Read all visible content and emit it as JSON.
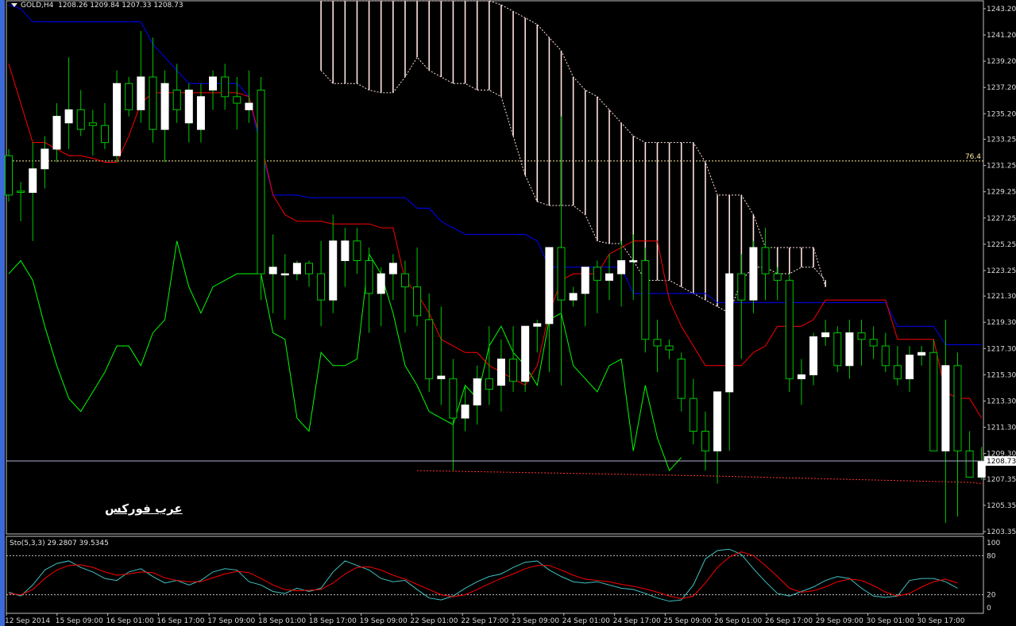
{
  "header": {
    "symbol": "GOLD,H4",
    "open": "1208.26",
    "high": "1209.84",
    "low": "1207.33",
    "close": "1208.73"
  },
  "indicator": {
    "name": "Sto(5,3,3)",
    "main": "29.2807",
    "signal": "39.5345"
  },
  "watermark": "عرب فوركس",
  "colors": {
    "background": "#000000",
    "grid_border": "#c0c0c0",
    "bull_candle": "#ffffff",
    "bear_candle": "#000000",
    "wick": "#00c800",
    "kijun": "#0000ff",
    "tenkan": "#ff0000",
    "chikou": "#00ff00",
    "cloud": "#ffe4e1",
    "stoch_main": "#40c0c0",
    "stoch_signal": "#ff0000",
    "level_line": "#ffeba0"
  },
  "chart_data": [
    {
      "type": "candlestick",
      "title": "",
      "ylim": [
        1202.5,
        1244.0
      ],
      "y_ticks": [
        "1243.20",
        "1241.20",
        "1239.20",
        "1237.20",
        "1235.20",
        "1233.25",
        "1231.25",
        "1229.25",
        "1227.25",
        "1225.25",
        "1223.25",
        "1221.30",
        "1219.30",
        "1217.30",
        "1215.30",
        "1213.30",
        "1211.30",
        "1209.30",
        "1207.35",
        "1205.35",
        "1203.35"
      ],
      "x_ticks": [
        "12 Sep 2014",
        "15 Sep 09:00",
        "16 Sep 01:00",
        "16 Sep 17:00",
        "17 Sep 09:00",
        "18 Sep 01:00",
        "18 Sep 17:00",
        "19 Sep 09:00",
        "22 Sep 01:00",
        "22 Sep 17:00",
        "23 Sep 09:00",
        "24 Sep 01:00",
        "24 Sep 17:00",
        "25 Sep 09:00",
        "26 Sep 01:00",
        "26 Sep 17:00",
        "29 Sep 09:00",
        "30 Sep 01:00",
        "30 Sep 17:00"
      ],
      "current_price": "1208.73",
      "current_price_value": 1208.73,
      "level": {
        "label": "76.4",
        "value": 1231.6
      },
      "ohlc": [
        [
          1232.0,
          1232.5,
          1228.5,
          1229.0
        ],
        [
          1229.3,
          1230.0,
          1227.0,
          1229.2
        ],
        [
          1229.2,
          1233.0,
          1225.5,
          1231.0
        ],
        [
          1231.0,
          1233.5,
          1229.5,
          1232.5
        ],
        [
          1232.5,
          1236.0,
          1231.5,
          1235.0
        ],
        [
          1234.5,
          1239.5,
          1232.5,
          1235.5
        ],
        [
          1235.5,
          1237.0,
          1233.5,
          1234.0
        ],
        [
          1234.5,
          1235.5,
          1232.0,
          1234.3
        ],
        [
          1234.3,
          1236.0,
          1232.5,
          1233.0
        ],
        [
          1232.0,
          1238.5,
          1231.5,
          1237.5
        ],
        [
          1237.5,
          1238.0,
          1235.0,
          1235.5
        ],
        [
          1235.5,
          1241.5,
          1234.5,
          1238.0
        ],
        [
          1238.0,
          1241.0,
          1233.0,
          1234.0
        ],
        [
          1234.0,
          1238.5,
          1231.5,
          1237.5
        ],
        [
          1237.0,
          1239.0,
          1234.5,
          1235.5
        ],
        [
          1234.5,
          1237.5,
          1233.0,
          1237.0
        ],
        [
          1234.0,
          1237.5,
          1233.0,
          1236.5
        ],
        [
          1237.0,
          1238.5,
          1235.5,
          1238.0
        ],
        [
          1238.0,
          1239.0,
          1235.5,
          1236.5
        ],
        [
          1236.5,
          1238.0,
          1234.0,
          1236.0
        ],
        [
          1235.5,
          1238.5,
          1234.5,
          1236.0
        ],
        [
          1237.0,
          1238.0,
          1221.0,
          1223.0
        ],
        [
          1223.0,
          1226.0,
          1220.0,
          1223.5
        ],
        [
          1223.0,
          1224.5,
          1219.5,
          1223.0
        ],
        [
          1223.0,
          1224.0,
          1222.5,
          1223.8
        ],
        [
          1223.8,
          1224.0,
          1222.0,
          1223.0
        ],
        [
          1223.0,
          1225.5,
          1219.0,
          1221.0
        ],
        [
          1221.0,
          1227.5,
          1220.0,
          1225.5
        ],
        [
          1224.0,
          1226.5,
          1222.0,
          1225.5
        ],
        [
          1225.5,
          1226.5,
          1223.0,
          1224.0
        ],
        [
          1224.0,
          1225.0,
          1218.5,
          1221.5
        ],
        [
          1221.5,
          1223.5,
          1219.0,
          1223.0
        ],
        [
          1223.0,
          1224.5,
          1221.0,
          1223.8
        ],
        [
          1223.0,
          1224.0,
          1218.5,
          1222.0
        ],
        [
          1222.0,
          1225.0,
          1219.0,
          1219.8
        ],
        [
          1219.5,
          1221.5,
          1214.0,
          1215.0
        ],
        [
          1215.0,
          1220.5,
          1213.0,
          1215.2
        ],
        [
          1215.0,
          1216.5,
          1208.0,
          1212.0
        ],
        [
          1212.0,
          1214.5,
          1211.0,
          1213.0
        ],
        [
          1213.0,
          1216.0,
          1211.5,
          1215.0
        ],
        [
          1215.0,
          1219.0,
          1213.0,
          1214.2
        ],
        [
          1214.5,
          1218.0,
          1212.5,
          1216.5
        ],
        [
          1216.5,
          1219.0,
          1214.0,
          1214.8
        ],
        [
          1214.8,
          1219.0,
          1214.0,
          1219.0
        ],
        [
          1219.0,
          1219.5,
          1217.0,
          1219.2
        ],
        [
          1219.2,
          1225.0,
          1215.5,
          1225.0
        ],
        [
          1225.0,
          1235.0,
          1214.5,
          1221.0
        ],
        [
          1221.0,
          1222.0,
          1220.5,
          1221.5
        ],
        [
          1221.5,
          1223.5,
          1219.0,
          1223.5
        ],
        [
          1223.5,
          1224.0,
          1220.0,
          1222.5
        ],
        [
          1222.5,
          1224.5,
          1221.0,
          1223.0
        ],
        [
          1223.0,
          1225.5,
          1220.5,
          1224.0
        ],
        [
          1224.0,
          1226.0,
          1221.0,
          1224.0
        ],
        [
          1224.0,
          1225.0,
          1217.0,
          1218.0
        ],
        [
          1218.0,
          1219.5,
          1215.5,
          1217.5
        ],
        [
          1217.5,
          1218.0,
          1216.5,
          1217.2
        ],
        [
          1216.5,
          1217.0,
          1212.5,
          1213.5
        ],
        [
          1213.5,
          1215.0,
          1210.0,
          1211.0
        ],
        [
          1211.0,
          1212.5,
          1208.0,
          1209.5
        ],
        [
          1209.5,
          1211.0,
          1207.0,
          1214.0
        ],
        [
          1214.0,
          1218.5,
          1209.5,
          1223.0
        ],
        [
          1223.0,
          1224.5,
          1216.5,
          1221.0
        ],
        [
          1221.0,
          1225.5,
          1220.0,
          1225.0
        ],
        [
          1225.0,
          1226.5,
          1221.0,
          1223.0
        ],
        [
          1223.0,
          1223.5,
          1221.0,
          1222.5
        ],
        [
          1222.5,
          1223.0,
          1214.0,
          1215.0
        ],
        [
          1215.0,
          1216.5,
          1213.0,
          1215.3
        ],
        [
          1215.3,
          1218.5,
          1214.5,
          1218.2
        ],
        [
          1218.2,
          1219.5,
          1217.5,
          1218.5
        ],
        [
          1218.5,
          1219.0,
          1215.5,
          1216.0
        ],
        [
          1216.0,
          1219.5,
          1215.0,
          1218.5
        ],
        [
          1218.5,
          1219.5,
          1216.0,
          1218.0
        ],
        [
          1218.0,
          1219.0,
          1216.5,
          1217.5
        ],
        [
          1217.5,
          1218.5,
          1215.5,
          1216.0
        ],
        [
          1216.0,
          1217.5,
          1214.5,
          1215.0
        ],
        [
          1215.0,
          1217.5,
          1214.0,
          1216.8
        ],
        [
          1216.8,
          1217.5,
          1216.0,
          1217.0
        ],
        [
          1217.0,
          1218.0,
          1211.0,
          1209.5
        ],
        [
          1209.5,
          1219.5,
          1204.0,
          1216.0
        ],
        [
          1216.0,
          1217.0,
          1204.5,
          1209.5
        ],
        [
          1209.5,
          1211.0,
          1207.5,
          1207.5
        ],
        [
          1207.5,
          1209.8,
          1207.3,
          1208.7
        ]
      ],
      "kijun": [
        1243.5,
        1243.2,
        1242.2,
        1242.2,
        1242.2,
        1242.2,
        1242.2,
        1242.2,
        1242.2,
        1242.2,
        1242.2,
        1242.2,
        1240.5,
        1239.5,
        1238.5,
        1237.5,
        1237.5,
        1237.5,
        1237.5,
        1237.5,
        1236.5,
        1232.5,
        1229.0,
        1229.0,
        1229.0,
        1228.8,
        1228.8,
        1228.8,
        1228.8,
        1228.8,
        1228.8,
        1228.8,
        1228.8,
        1228.8,
        1228.0,
        1228.0,
        1227.0,
        1226.5,
        1226.0,
        1226.0,
        1226.0,
        1226.0,
        1226.0,
        1226.0,
        1225.5,
        1223.5,
        1223.5,
        1223.5,
        1223.5,
        1223.5,
        1223.5,
        1223.5,
        1221.5,
        1221.5,
        1221.5,
        1221.5,
        1221.5,
        1221.5,
        1221.5,
        1220.8,
        1220.8,
        1220.8,
        1220.8,
        1220.8,
        1220.8,
        1220.8,
        1220.8,
        1220.8,
        1220.8,
        1220.8,
        1220.8,
        1220.8,
        1220.8,
        1220.8,
        1219.0,
        1219.0,
        1219.0,
        1219.0,
        1217.6,
        1217.6,
        1217.6,
        1217.6
      ],
      "tenkan": [
        1239.0,
        1236.0,
        1233.0,
        1233.0,
        1232.5,
        1232.0,
        1232.0,
        1231.8,
        1231.5,
        1231.5,
        1233.5,
        1236.0,
        1236.8,
        1236.8,
        1236.8,
        1236.8,
        1236.8,
        1236.8,
        1236.8,
        1236.8,
        1236.5,
        1233.0,
        1229.0,
        1227.5,
        1227.0,
        1227.0,
        1227.0,
        1226.8,
        1226.8,
        1226.8,
        1226.8,
        1226.5,
        1226.5,
        1222.5,
        1221.5,
        1220.0,
        1218.0,
        1217.5,
        1217.0,
        1217.0,
        1216.0,
        1215.5,
        1215.0,
        1214.5,
        1216.0,
        1220.0,
        1222.5,
        1223.0,
        1223.0,
        1223.0,
        1224.5,
        1225.0,
        1225.5,
        1225.5,
        1225.5,
        1221.0,
        1219.0,
        1217.5,
        1216.0,
        1216.0,
        1216.0,
        1216.0,
        1217.0,
        1217.5,
        1219.0,
        1219.0,
        1219.0,
        1219.5,
        1221.0,
        1221.0,
        1221.0,
        1221.0,
        1221.0,
        1221.0,
        1218.0,
        1218.0,
        1218.0,
        1218.0,
        1214.0,
        1213.5,
        1213.5,
        1212.0
      ],
      "chikou": [
        1223.0,
        1224.0,
        1222.5,
        1219.0,
        1216.0,
        1213.5,
        1212.5,
        1214.0,
        1215.5,
        1217.5,
        1217.5,
        1216.0,
        1218.5,
        1219.5,
        1225.5,
        1222.0,
        1220.0,
        1222.0,
        1222.5,
        1223.0,
        1223.0,
        1223.0,
        1218.5,
        1218.0,
        1212.0,
        1211.0,
        1217.0,
        1216.0,
        1216.0,
        1216.5,
        1224.5,
        1223.0,
        1220.0,
        1216.0,
        1214.5,
        1212.5,
        1212.0,
        1211.5,
        1214.5,
        1213.5,
        1217.5,
        1219.0,
        1217.0,
        1216.0,
        1214.5,
        1219.5,
        1220.0,
        1216.0,
        1215.0,
        1214.0,
        1216.0,
        1216.5,
        1209.5,
        1214.5,
        1210.5,
        1208.0,
        1209.0
      ],
      "cloud": {
        "start_bar": 26,
        "span_a": [
          1244.0,
          1244.0,
          1244.0,
          1244.0,
          1244.0,
          1244.0,
          1244.0,
          1244.0,
          1244.0,
          1244.0,
          1244.0,
          1244.0,
          1244.0,
          1244.0,
          1244.0,
          1243.5,
          1243.0,
          1242.5,
          1242.0,
          1241.0,
          1240.0,
          1238.0,
          1237.0,
          1236.5,
          1235.5,
          1234.5,
          1233.5,
          1233.0,
          1233.0,
          1233.0,
          1233.0,
          1233.0,
          1231.5,
          1229.0,
          1229.0,
          1229.0,
          1227.5,
          1225.0,
          1225.0,
          1225.0,
          1225.0,
          1225.0,
          1222.0
        ],
        "span_b": [
          1238.5,
          1237.5,
          1237.5,
          1237.5,
          1237.0,
          1236.8,
          1236.8,
          1238.0,
          1239.5,
          1238.5,
          1238.0,
          1237.5,
          1237.5,
          1237.0,
          1237.0,
          1236.5,
          1233.5,
          1230.5,
          1228.5,
          1228.2,
          1228.2,
          1228.2,
          1227.5,
          1225.5,
          1225.3,
          1225.3,
          1224.0,
          1222.5,
          1222.5,
          1222.5,
          1222.0,
          1221.5,
          1221.0,
          1220.5,
          1220.0,
          1222.5,
          1223.5,
          1223.5,
          1223.0,
          1223.0,
          1223.5,
          1223.5,
          1222.5
        ]
      }
    },
    {
      "type": "line",
      "title": "",
      "ylim": [
        0,
        100
      ],
      "y_ticks": [
        "100",
        "80",
        "20",
        "0"
      ],
      "levels": [
        80,
        20
      ],
      "series": [
        {
          "values": [
            24,
            18,
            35,
            58,
            68,
            72,
            62,
            55,
            45,
            42,
            55,
            60,
            48,
            38,
            42,
            35,
            42,
            55,
            60,
            58,
            40,
            35,
            25,
            22,
            30,
            25,
            30,
            55,
            72,
            65,
            58,
            45,
            40,
            42,
            28,
            15,
            12,
            18,
            30,
            40,
            48,
            52,
            62,
            70,
            72,
            58,
            48,
            40,
            38,
            40,
            35,
            30,
            28,
            22,
            15,
            10,
            12,
            35,
            75,
            88,
            90,
            82,
            60,
            40,
            22,
            18,
            25,
            32,
            42,
            48,
            45,
            30,
            18,
            16,
            18,
            42,
            45,
            45,
            40,
            30
          ]
        },
        {
          "values": [
            22,
            20,
            28,
            45,
            58,
            65,
            66,
            62,
            55,
            50,
            52,
            55,
            54,
            46,
            42,
            40,
            40,
            46,
            52,
            56,
            54,
            45,
            35,
            28,
            26,
            27,
            28,
            38,
            52,
            62,
            63,
            58,
            50,
            44,
            36,
            28,
            20,
            17,
            20,
            28,
            37,
            45,
            52,
            60,
            65,
            65,
            58,
            50,
            44,
            42,
            40,
            36,
            33,
            29,
            24,
            18,
            14,
            18,
            38,
            62,
            78,
            86,
            80,
            65,
            48,
            30,
            24,
            26,
            32,
            40,
            44,
            42,
            34,
            24,
            18,
            22,
            32,
            40,
            44,
            38
          ]
        }
      ]
    }
  ]
}
